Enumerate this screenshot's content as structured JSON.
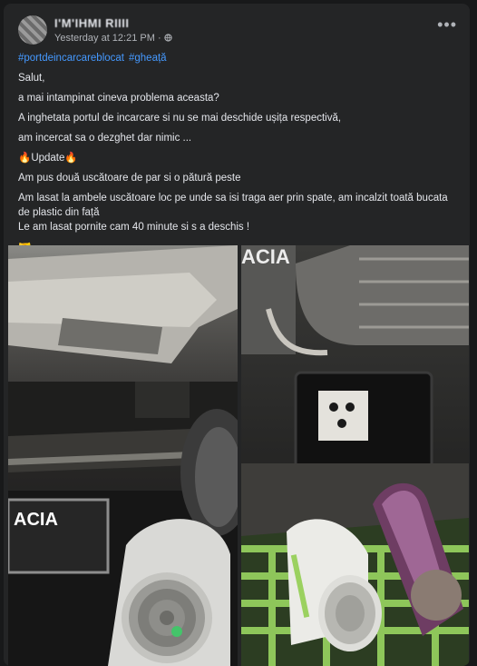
{
  "post": {
    "author": "I'M'IHMI RIIII",
    "timestamp": "Yesterday at 12:21 PM",
    "privacy_sep": "·",
    "hashtags": [
      "#portdeincarcareblocat",
      "#gheață"
    ],
    "paragraphs": [
      "Salut,",
      "a mai intampinat cineva problema aceasta?",
      "A inghetata portul de incarcare si nu se mai deschide ușița respectivă,",
      "am incercat sa o dezghet dar nimic ...",
      "🔥Update🔥",
      "Am pus două uscătoare de par si o pătură peste",
      "Am lasat la ambele uscătoare loc pe unde sa isi traga aer prin spate, am incalzit toată bucata de plastic din față",
      "Le am lasat pornite cam 40 minute si s a deschis !",
      "🤝"
    ],
    "brand_left": "ACIA",
    "brand_right": "ACIA"
  },
  "colors": {
    "link": "#4599ff",
    "card": "#242526",
    "page": "#18191a",
    "text": "#e4e6eb",
    "muted": "#b0b3b8"
  }
}
